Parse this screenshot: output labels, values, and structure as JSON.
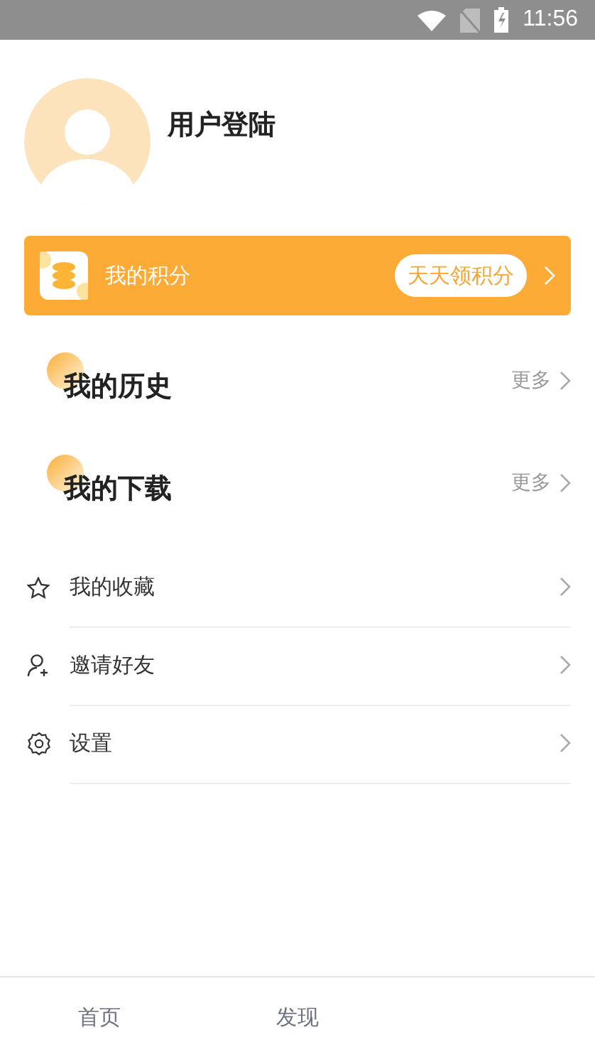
{
  "status_bar": {
    "time": "11:56"
  },
  "profile": {
    "name": "用户登陆"
  },
  "points_card": {
    "label": "我的积分",
    "action": "天天领积分"
  },
  "sections": [
    {
      "title": "我的历史",
      "more": "更多"
    },
    {
      "title": "我的下载",
      "more": "更多"
    }
  ],
  "menu": [
    {
      "kind": "star",
      "label": "我的收藏"
    },
    {
      "kind": "invite",
      "label": "邀请好友"
    },
    {
      "kind": "settings",
      "label": "设置"
    }
  ],
  "tab_bar": [
    {
      "label": "首页"
    },
    {
      "label": "发现"
    }
  ]
}
